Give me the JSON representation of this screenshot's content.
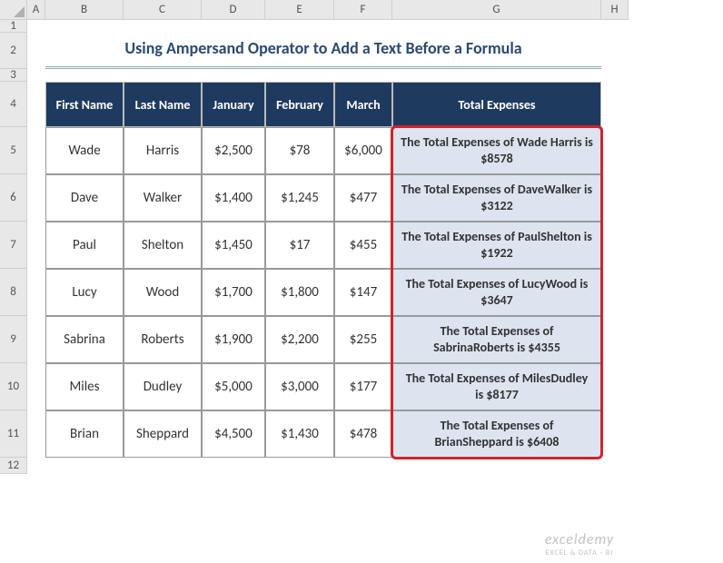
{
  "columns": [
    "A",
    "B",
    "C",
    "D",
    "E",
    "F",
    "G",
    "H"
  ],
  "rows": [
    "1",
    "2",
    "3",
    "4",
    "5",
    "6",
    "7",
    "8",
    "9",
    "10",
    "11",
    "12"
  ],
  "title": "Using Ampersand Operator to Add a Text Before a Formula",
  "headers": {
    "first": "First Name",
    "last": "Last Name",
    "jan": "January",
    "feb": "February",
    "mar": "March",
    "total": "Total Expenses"
  },
  "data": [
    {
      "first": "Wade",
      "last": "Harris",
      "jan": "$2,500",
      "feb": "$78",
      "mar": "$6,000",
      "result": "The Total Expenses of Wade Harris is $8578"
    },
    {
      "first": "Dave",
      "last": "Walker",
      "jan": "$1,400",
      "feb": "$1,245",
      "mar": "$477",
      "result": "The Total Expenses of DaveWalker is $3122"
    },
    {
      "first": "Paul",
      "last": "Shelton",
      "jan": "$1,450",
      "feb": "$17",
      "mar": "$455",
      "result": "The Total Expenses of PaulShelton is $1922"
    },
    {
      "first": "Lucy",
      "last": "Wood",
      "jan": "$1,700",
      "feb": "$1,800",
      "mar": "$147",
      "result": "The Total Expenses of LucyWood is $3647"
    },
    {
      "first": "Sabrina",
      "last": "Roberts",
      "jan": "$1,900",
      "feb": "$2,200",
      "mar": "$255",
      "result": "The Total Expenses of SabrinaRoberts is $4355"
    },
    {
      "first": "Miles",
      "last": "Dudley",
      "jan": "$5,000",
      "feb": "$3,000",
      "mar": "$177",
      "result": "The Total Expenses of MilesDudley is $8177"
    },
    {
      "first": "Brian",
      "last": "Sheppard",
      "jan": "$4,500",
      "feb": "$1,430",
      "mar": "$478",
      "result": "The Total Expenses of BrianSheppard is $6408"
    }
  ],
  "watermark": {
    "line1": "exceldemy",
    "line2": "EXCEL & DATA - BI"
  }
}
